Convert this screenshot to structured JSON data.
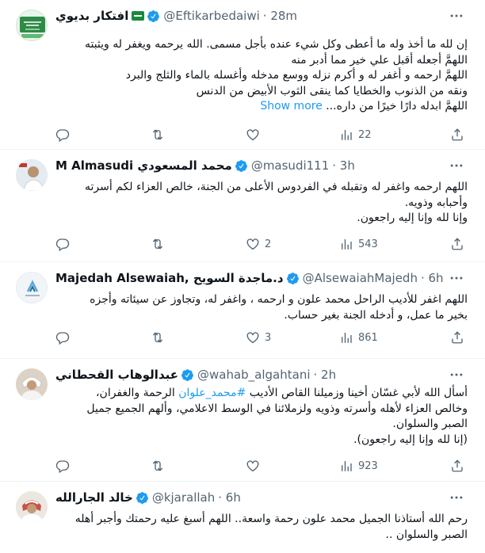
{
  "colors": {
    "accent": "#1d9bf0",
    "verified": "#1d9bf0",
    "muted": "#536471"
  },
  "tweets": [
    {
      "name": "افتكار بديوي",
      "handle": "@Eftikarbedaiwi",
      "time": "· 28m",
      "flag": "saudi-flag-badge",
      "lines": [
        "إن لله ما أخذ وله ما أعطى وكل شيء عنده بأجل مسمى. الله يرحمه ويغفر له ويثبته",
        "اللهمَّ أجعله أقبل علي خير مما أدبر منه",
        "اللهمَّ ارحمه و أغفر له و أكرم نزله ووسع مدخله وأغسله بالماء والثلج والبرد",
        "ونقه من الذنوب والخطايا كما ينقى الثوب الأبيض من الدنس",
        "اللهمَّ ابدله دارًا خيرًا من داره..."
      ],
      "show_more": "Show more",
      "replies": "",
      "retweets": "",
      "likes": "",
      "views": "22"
    },
    {
      "name": "M Almasudi محمد المسعودي",
      "handle": "@masudi111",
      "time": "· 3h",
      "lines": [
        "اللهم ارحمه واغفر له وتقبله في الفردوس الأعلى من الجنة، خالص العزاء لكم أسرته",
        "وأحبابه وذويه.",
        "وإنا لله وإنا إليه راجعون."
      ],
      "replies": "",
      "retweets": "",
      "likes": "2",
      "views": "543"
    },
    {
      "name": "Majedah Alsewaiah, د.ماجدة السويح",
      "handle": "@AlsewaiahMajedh",
      "time": "· 6h",
      "lines": [
        "اللهم اغفر للأديب الراحل محمد علون و ارحمه ،  واغفر له، وتجاوز عن سيئاته وأجزه",
        "بخير ما عمل، و أدخله الجنة بغير حساب."
      ],
      "replies": "",
      "retweets": "",
      "likes": "3",
      "views": "861"
    },
    {
      "name": "عبدالوهاب القحطاني",
      "handle": "@wahab_algahtani",
      "time": "· 2h",
      "line1_pre": "أسأل الله لأبي غسّان أخينا وزميلنا القاص الأديب ",
      "hashtag": "#محمد_علوان",
      "line1_post": " الرحمة والغفران،",
      "lines": [
        "وخالص العزاء لأهله وأسرته وذويه ولزملائنا في الوسط الاعلامي، وألهم الجميع جميل",
        "الصبر والسلوان.",
        "(إنا لله وإنا إليه راجعون)."
      ],
      "replies": "",
      "retweets": "",
      "likes": "",
      "views": "923"
    },
    {
      "name": "خالد الجارالله",
      "handle": "@kjarallah",
      "time": "· 6h",
      "lines": [
        "رحم الله أستاذنا الجميل محمد علون رحمة واسعة.. اللهم أسبغ عليه رحمتك وأجبر أهله",
        "الصبر والسلوان .."
      ]
    }
  ]
}
